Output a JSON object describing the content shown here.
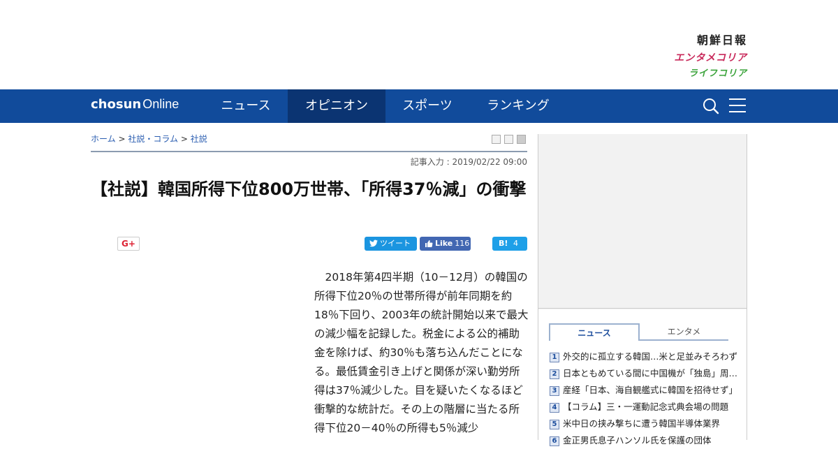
{
  "header": {
    "logo_main": "朝鮮日報",
    "logo_enta": "エンタメコリア",
    "logo_life": "ライフコリア"
  },
  "nav": {
    "brand_bold": "chosun",
    "brand_light": "Online",
    "items": [
      {
        "label": "ニュース",
        "active": false
      },
      {
        "label": "オピニオン",
        "active": true
      },
      {
        "label": "スポーツ",
        "active": false
      },
      {
        "label": "ランキング",
        "active": false
      }
    ],
    "icons": [
      "search-icon",
      "menu-icon"
    ]
  },
  "breadcrumb": {
    "items": [
      "ホーム",
      "社説・コラム",
      "社説"
    ],
    "separator": ">"
  },
  "article": {
    "date": "記事入力 : 2019/02/22 09:00",
    "title": "【社説】韓国所得下位800万世帯、「所得37％減」の衝撃",
    "body": "2018年第4四半期（10－12月）の韓国の所得下位20％の世帯所得が前年同期を約18％下回り、2003年の統計開始以来で最大の減少幅を記録した。税金による公的補助金を除けば、約30％も落ち込んだことになる。最低賃金引き上げと関係が深い勤労所得は37％減少した。目を疑いたくなるほど衝撃的な統計だ。その上の階層に当たる所得下位20－40％の所得も5％減少"
  },
  "share": {
    "gplus": "G+",
    "tweet": "ツイート",
    "fb_like": "Like",
    "fb_count": "116",
    "hatena_label": "B!",
    "hatena_count": "4"
  },
  "sidebar": {
    "tabs": [
      "ニュース",
      "エンタメ"
    ],
    "active_tab": "ニュース",
    "news": [
      {
        "rank": "1",
        "title": "外交的に孤立する韓国…米と足並みそろわず"
      },
      {
        "rank": "2",
        "title": "日本ともめている間に中国機が「独島」周辺に"
      },
      {
        "rank": "3",
        "title": "産経「日本、海自観艦式に韓国を招待せず」"
      },
      {
        "rank": "4",
        "title": "【コラム】三・一運動記念式典会場の問題"
      },
      {
        "rank": "5",
        "title": "米中日の挟み撃ちに遭う韓国半導体業界"
      },
      {
        "rank": "6",
        "title": "金正男氏息子ハンソル氏を保護の団体"
      }
    ]
  },
  "colors": {
    "nav_bg": "#114b9b",
    "nav_active": "#0b3472",
    "enta": "#c8285a",
    "life": "#3aa33a"
  }
}
